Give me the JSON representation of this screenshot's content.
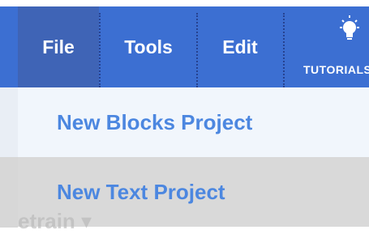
{
  "menubar": {
    "items": [
      {
        "label": "File"
      },
      {
        "label": "Tools"
      },
      {
        "label": "Edit"
      }
    ],
    "tutorials_label": "TUTORIALS",
    "colors": {
      "bar": "#3c6fd2",
      "active": "#3f64b6",
      "text": "#ffffff"
    }
  },
  "file_menu": {
    "items": [
      {
        "label": "New Blocks Project"
      },
      {
        "label": "New Text Project"
      }
    ],
    "colors": {
      "text": "#4c87e0",
      "hover_bg": "#f1f6fc",
      "bg": "#d9d9d9"
    }
  },
  "background": {
    "project_title": "etrain ▾"
  },
  "icons": {
    "tutorials": "lightbulb-icon"
  }
}
